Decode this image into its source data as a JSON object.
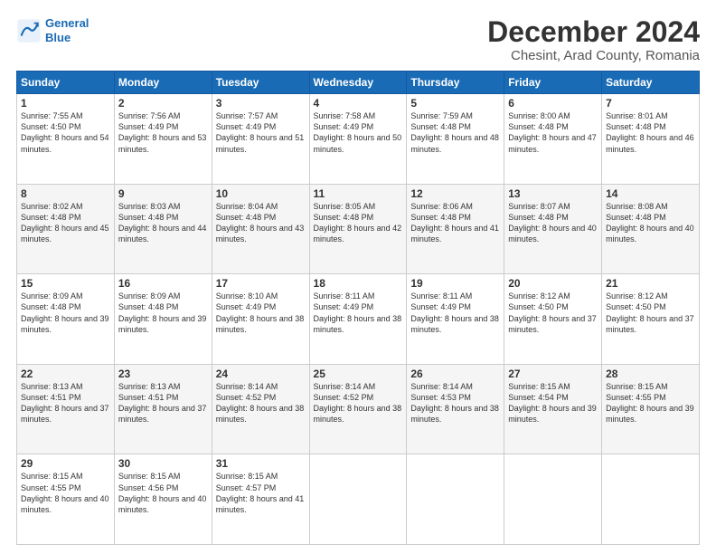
{
  "logo": {
    "line1": "General",
    "line2": "Blue"
  },
  "title": "December 2024",
  "subtitle": "Chesint, Arad County, Romania",
  "weekdays": [
    "Sunday",
    "Monday",
    "Tuesday",
    "Wednesday",
    "Thursday",
    "Friday",
    "Saturday"
  ],
  "weeks": [
    [
      {
        "day": "1",
        "sunrise": "7:55 AM",
        "sunset": "4:50 PM",
        "daylight": "8 hours and 54 minutes."
      },
      {
        "day": "2",
        "sunrise": "7:56 AM",
        "sunset": "4:49 PM",
        "daylight": "8 hours and 53 minutes."
      },
      {
        "day": "3",
        "sunrise": "7:57 AM",
        "sunset": "4:49 PM",
        "daylight": "8 hours and 51 minutes."
      },
      {
        "day": "4",
        "sunrise": "7:58 AM",
        "sunset": "4:49 PM",
        "daylight": "8 hours and 50 minutes."
      },
      {
        "day": "5",
        "sunrise": "7:59 AM",
        "sunset": "4:48 PM",
        "daylight": "8 hours and 48 minutes."
      },
      {
        "day": "6",
        "sunrise": "8:00 AM",
        "sunset": "4:48 PM",
        "daylight": "8 hours and 47 minutes."
      },
      {
        "day": "7",
        "sunrise": "8:01 AM",
        "sunset": "4:48 PM",
        "daylight": "8 hours and 46 minutes."
      }
    ],
    [
      {
        "day": "8",
        "sunrise": "8:02 AM",
        "sunset": "4:48 PM",
        "daylight": "8 hours and 45 minutes."
      },
      {
        "day": "9",
        "sunrise": "8:03 AM",
        "sunset": "4:48 PM",
        "daylight": "8 hours and 44 minutes."
      },
      {
        "day": "10",
        "sunrise": "8:04 AM",
        "sunset": "4:48 PM",
        "daylight": "8 hours and 43 minutes."
      },
      {
        "day": "11",
        "sunrise": "8:05 AM",
        "sunset": "4:48 PM",
        "daylight": "8 hours and 42 minutes."
      },
      {
        "day": "12",
        "sunrise": "8:06 AM",
        "sunset": "4:48 PM",
        "daylight": "8 hours and 41 minutes."
      },
      {
        "day": "13",
        "sunrise": "8:07 AM",
        "sunset": "4:48 PM",
        "daylight": "8 hours and 40 minutes."
      },
      {
        "day": "14",
        "sunrise": "8:08 AM",
        "sunset": "4:48 PM",
        "daylight": "8 hours and 40 minutes."
      }
    ],
    [
      {
        "day": "15",
        "sunrise": "8:09 AM",
        "sunset": "4:48 PM",
        "daylight": "8 hours and 39 minutes."
      },
      {
        "day": "16",
        "sunrise": "8:09 AM",
        "sunset": "4:48 PM",
        "daylight": "8 hours and 39 minutes."
      },
      {
        "day": "17",
        "sunrise": "8:10 AM",
        "sunset": "4:49 PM",
        "daylight": "8 hours and 38 minutes."
      },
      {
        "day": "18",
        "sunrise": "8:11 AM",
        "sunset": "4:49 PM",
        "daylight": "8 hours and 38 minutes."
      },
      {
        "day": "19",
        "sunrise": "8:11 AM",
        "sunset": "4:49 PM",
        "daylight": "8 hours and 38 minutes."
      },
      {
        "day": "20",
        "sunrise": "8:12 AM",
        "sunset": "4:50 PM",
        "daylight": "8 hours and 37 minutes."
      },
      {
        "day": "21",
        "sunrise": "8:12 AM",
        "sunset": "4:50 PM",
        "daylight": "8 hours and 37 minutes."
      }
    ],
    [
      {
        "day": "22",
        "sunrise": "8:13 AM",
        "sunset": "4:51 PM",
        "daylight": "8 hours and 37 minutes."
      },
      {
        "day": "23",
        "sunrise": "8:13 AM",
        "sunset": "4:51 PM",
        "daylight": "8 hours and 37 minutes."
      },
      {
        "day": "24",
        "sunrise": "8:14 AM",
        "sunset": "4:52 PM",
        "daylight": "8 hours and 38 minutes."
      },
      {
        "day": "25",
        "sunrise": "8:14 AM",
        "sunset": "4:52 PM",
        "daylight": "8 hours and 38 minutes."
      },
      {
        "day": "26",
        "sunrise": "8:14 AM",
        "sunset": "4:53 PM",
        "daylight": "8 hours and 38 minutes."
      },
      {
        "day": "27",
        "sunrise": "8:15 AM",
        "sunset": "4:54 PM",
        "daylight": "8 hours and 39 minutes."
      },
      {
        "day": "28",
        "sunrise": "8:15 AM",
        "sunset": "4:55 PM",
        "daylight": "8 hours and 39 minutes."
      }
    ],
    [
      {
        "day": "29",
        "sunrise": "8:15 AM",
        "sunset": "4:55 PM",
        "daylight": "8 hours and 40 minutes."
      },
      {
        "day": "30",
        "sunrise": "8:15 AM",
        "sunset": "4:56 PM",
        "daylight": "8 hours and 40 minutes."
      },
      {
        "day": "31",
        "sunrise": "8:15 AM",
        "sunset": "4:57 PM",
        "daylight": "8 hours and 41 minutes."
      },
      null,
      null,
      null,
      null
    ]
  ]
}
